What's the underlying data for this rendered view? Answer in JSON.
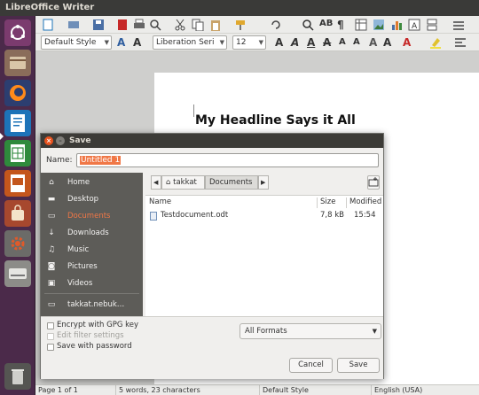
{
  "app": {
    "title": "LibreOffice Writer"
  },
  "toolbar": {
    "paragraph_style": "Default Style",
    "font_name": "Liberation Seri",
    "font_size": "12"
  },
  "document": {
    "headline": "My Headline Says it All"
  },
  "status_bar": {
    "page": "Page 1 of 1",
    "words": "5 words, 23 characters",
    "style": "Default Style",
    "language": "English (USA)"
  },
  "dialog": {
    "title": "Save",
    "name_label": "Name:",
    "name_value": "Untitled 1",
    "places": [
      {
        "label": "Home",
        "icon": "home-icon"
      },
      {
        "label": "Desktop",
        "icon": "folder-icon"
      },
      {
        "label": "Documents",
        "icon": "document-icon"
      },
      {
        "label": "Downloads",
        "icon": "download-icon"
      },
      {
        "label": "Music",
        "icon": "music-icon"
      },
      {
        "label": "Pictures",
        "icon": "camera-icon"
      },
      {
        "label": "Videos",
        "icon": "video-icon"
      },
      {
        "label": "takkat.nebuk…",
        "icon": "drive-icon"
      }
    ],
    "active_place": "Documents",
    "breadcrumbs": [
      "takkat",
      "Documents"
    ],
    "columns": {
      "name": "Name",
      "size": "Size",
      "modified": "Modified"
    },
    "files": [
      {
        "name": "Testdocument.odt",
        "size": "7,8 kB",
        "modified": "15:54"
      }
    ],
    "options": {
      "encrypt": "Encrypt with GPG key",
      "edit_filter": "Edit filter settings",
      "save_password": "Save with password"
    },
    "format": "All Formats",
    "cancel": "Cancel",
    "save": "Save"
  },
  "colors": {
    "accent": "#f07746",
    "sidebar_bg": "#5d5c58",
    "launcher_bg": "#4b2a4a",
    "titlebar_bg": "#3c3b37"
  }
}
